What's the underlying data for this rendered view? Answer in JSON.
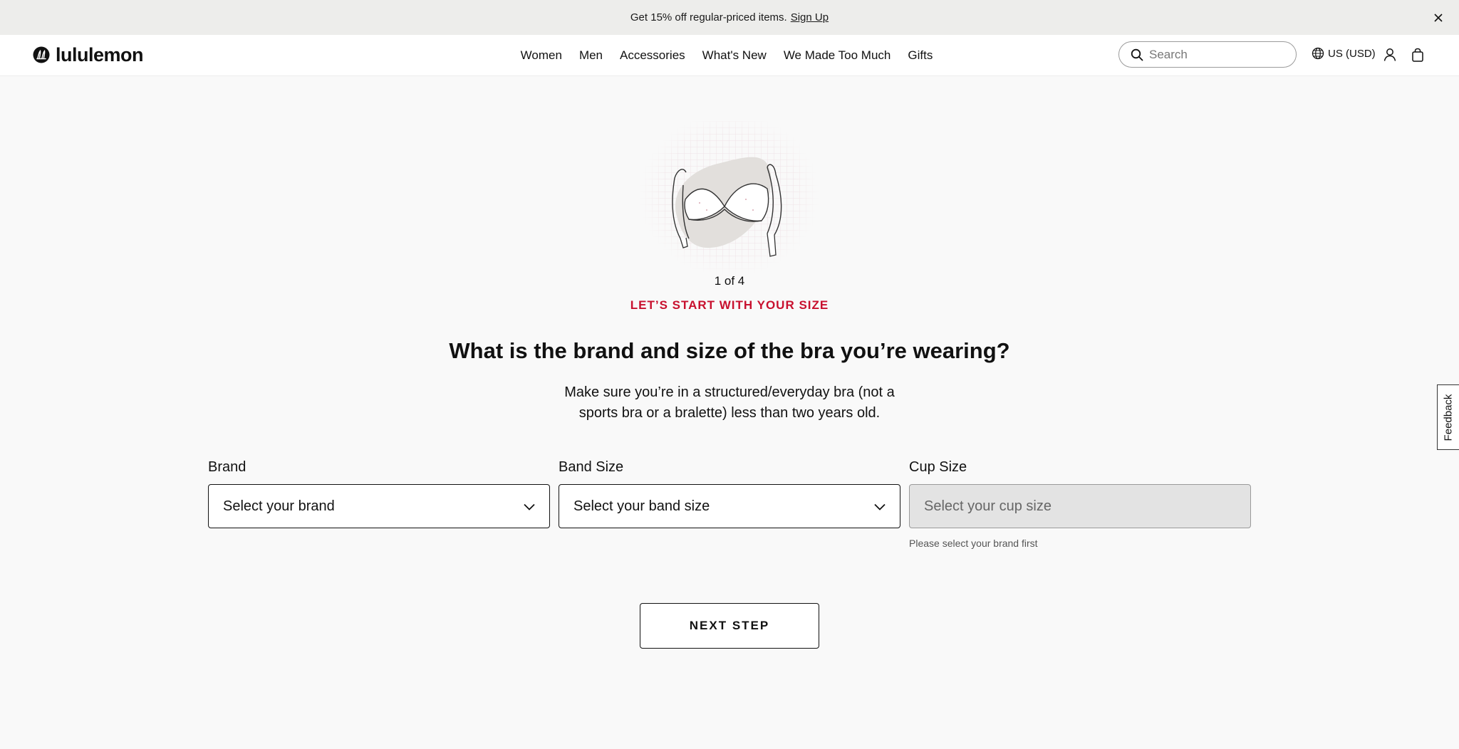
{
  "promo": {
    "text": "Get 15% off regular-priced items.",
    "link": "Sign Up"
  },
  "header": {
    "logo_text": "lululemon",
    "nav": [
      "Women",
      "Men",
      "Accessories",
      "What's New",
      "We Made Too Much",
      "Gifts"
    ],
    "search_placeholder": "Search",
    "locale": "US (USD)"
  },
  "quiz": {
    "step": "1 of 4",
    "eyebrow": "LET’S START WITH YOUR SIZE",
    "question": "What is the brand and size of the bra you’re wearing?",
    "subtitle": "Make sure you’re in a structured/everyday bra (not a sports bra or a bralette) less than two years old.",
    "fields": {
      "brand": {
        "label": "Brand",
        "placeholder": "Select your brand"
      },
      "band": {
        "label": "Band Size",
        "placeholder": "Select your band size"
      },
      "cup": {
        "label": "Cup Size",
        "placeholder": "Select your cup size",
        "help": "Please select your brand first"
      }
    },
    "next_button": "NEXT STEP"
  },
  "feedback_label": "Feedback",
  "colors": {
    "accent": "#c8102e",
    "promo_bg": "#ededeb",
    "page_bg": "#f9f9f9",
    "disabled_bg": "#e3e3e3"
  }
}
